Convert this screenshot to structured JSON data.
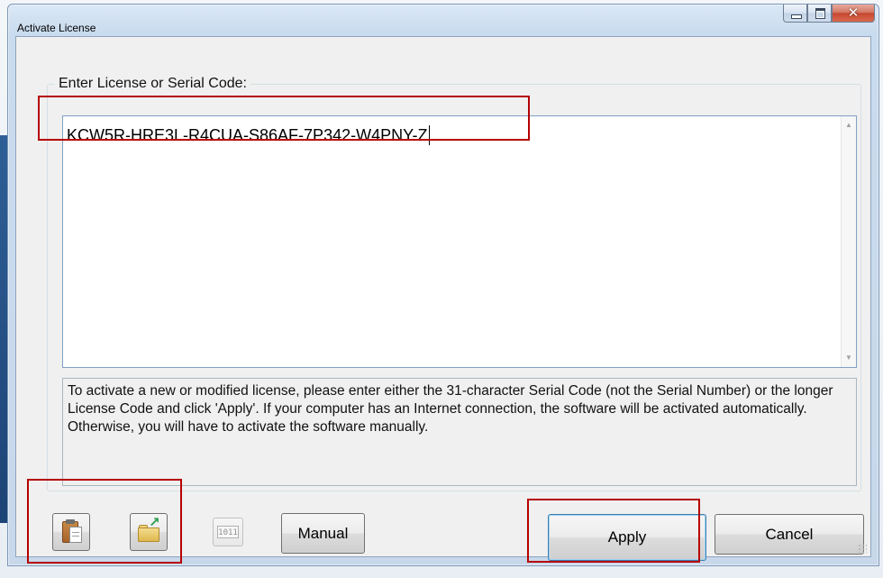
{
  "window": {
    "title": "Activate License",
    "controls": {
      "minimize_icon": "minimize-icon",
      "maximize_icon": "maximize-icon",
      "close_icon": "close-icon"
    }
  },
  "form": {
    "group_label": "Enter License or Serial Code:",
    "license_code": "KCW5R-HRE3L-R4CUA-S86AF-7P342-W4PNY-Z",
    "scroll_up_glyph": "▲",
    "scroll_down_glyph": "▼",
    "info_text": "To activate a new or modified license, please enter either the 31-character Serial Code (not the Serial Number) or the longer License Code and click 'Apply'.  If your computer has an Internet connection, the software will be activated automatically.  Otherwise, you will have to activate the software manually."
  },
  "actions": {
    "paste_button_icon": "clipboard-icon",
    "open_button_icon": "folder-open-icon",
    "binary_button_icon": "binary-icon",
    "binary_label": "1011",
    "manual_label": "Manual",
    "apply_label": "Apply",
    "cancel_label": "Cancel"
  },
  "annotations": {
    "highlight_color": "#b60000"
  },
  "colors": {
    "window_frame": "#c8d8eb",
    "client_bg": "#f0f0f0",
    "apply_border": "#3c7fb1"
  }
}
